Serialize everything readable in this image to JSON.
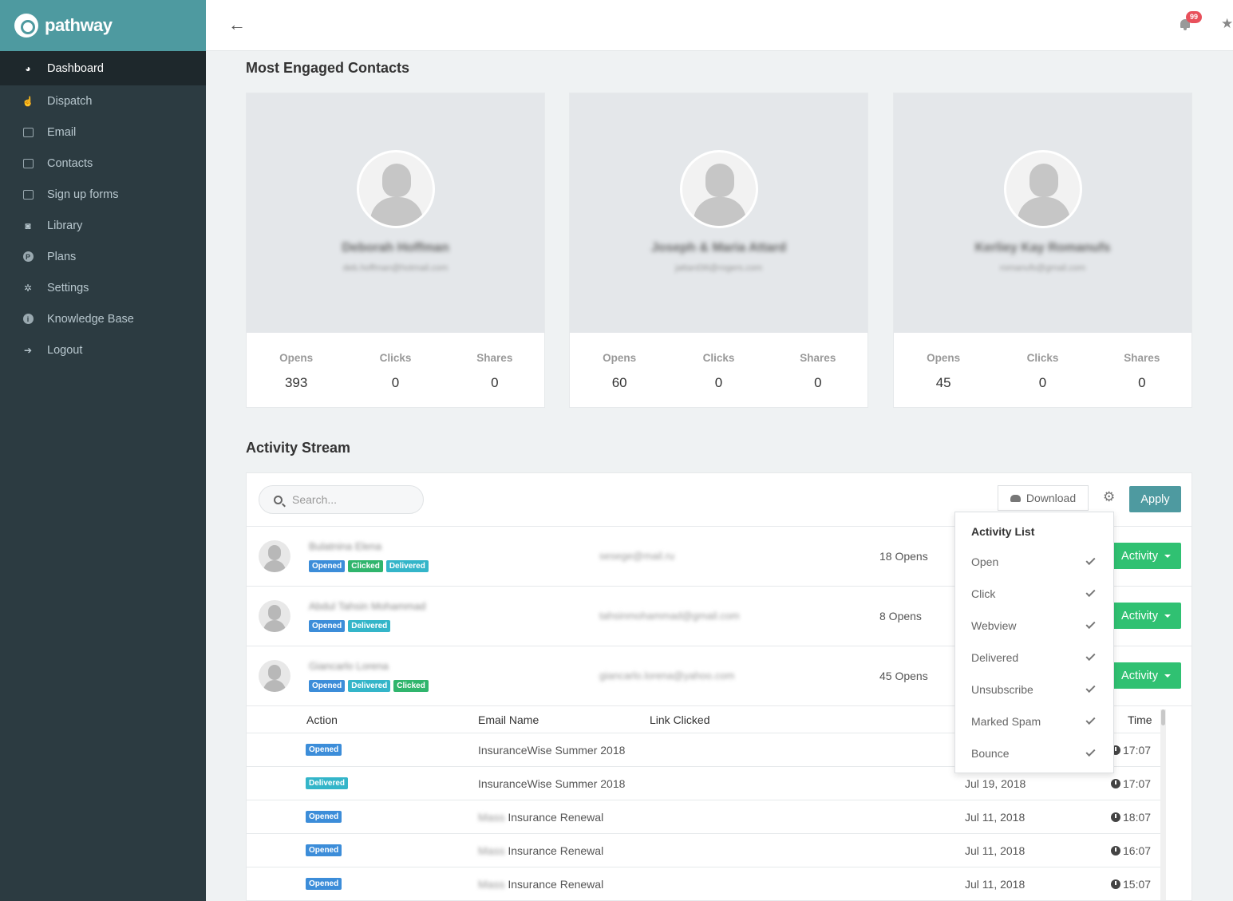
{
  "brand": {
    "name": "pathway"
  },
  "sidebar": {
    "items": [
      {
        "label": "Dashboard"
      },
      {
        "label": "Dispatch"
      },
      {
        "label": "Email"
      },
      {
        "label": "Contacts"
      },
      {
        "label": "Sign up forms"
      },
      {
        "label": "Library"
      },
      {
        "label": "Plans"
      },
      {
        "label": "Settings"
      },
      {
        "label": "Knowledge Base"
      },
      {
        "label": "Logout"
      }
    ]
  },
  "header": {
    "notification_count": "99"
  },
  "engaged": {
    "title": "Most Engaged Contacts",
    "stat_labels": {
      "opens": "Opens",
      "clicks": "Clicks",
      "shares": "Shares"
    },
    "contacts": [
      {
        "name": "Deborah Hoffman",
        "email": "deb.hoffman@hotmail.com",
        "opens": "393",
        "clicks": "0",
        "shares": "0"
      },
      {
        "name": "Joseph & Maria Attard",
        "email": "jattard36@rogers.com",
        "opens": "60",
        "clicks": "0",
        "shares": "0"
      },
      {
        "name": "Kerliey Kay Romanufs",
        "email": "romanufs@gmail.com",
        "opens": "45",
        "clicks": "0",
        "shares": "0"
      }
    ]
  },
  "activity": {
    "title": "Activity Stream",
    "search_placeholder": "Search...",
    "download_label": "Download",
    "apply_label": "Apply",
    "activity_button": "Activity",
    "tag_labels": {
      "opened": "Opened",
      "clicked": "Clicked",
      "delivered": "Delivered"
    },
    "rows": [
      {
        "name": "Bulatnina Elena",
        "email": "sesege@mail.ru",
        "opens": "18 Opens"
      },
      {
        "name": "Abdul Tahsin Mohammad",
        "email": "tahsinmohammad@gmail.com",
        "opens": "8 Opens"
      },
      {
        "name": "Giancarlo Lorena",
        "email": "giancarlo.lorena@yahoo.com",
        "opens": "45 Opens"
      }
    ],
    "detail": {
      "headers": {
        "action": "Action",
        "email_name": "Email Name",
        "link_clicked": "Link Clicked",
        "time": "Time"
      },
      "rows": [
        {
          "action": "Opened",
          "email_name": "InsuranceWise Summer 2018",
          "prefix": "",
          "date": "",
          "time": "17:07",
          "color": "#3c8dd9"
        },
        {
          "action": "Delivered",
          "email_name": "InsuranceWise Summer 2018",
          "prefix": "",
          "date": "Jul 19, 2018",
          "time": "17:07",
          "color": "#34b5c9"
        },
        {
          "action": "Opened",
          "email_name": "Insurance Renewal",
          "prefix": "Mass",
          "date": "Jul 11, 2018",
          "time": "18:07",
          "color": "#3c8dd9"
        },
        {
          "action": "Opened",
          "email_name": "Insurance Renewal",
          "prefix": "Mass",
          "date": "Jul 11, 2018",
          "time": "16:07",
          "color": "#3c8dd9"
        },
        {
          "action": "Opened",
          "email_name": "Insurance Renewal",
          "prefix": "Mass",
          "date": "Jul 11, 2018",
          "time": "15:07",
          "color": "#3c8dd9"
        }
      ]
    }
  },
  "dropdown": {
    "title": "Activity List",
    "items": [
      {
        "label": "Open",
        "checked": true
      },
      {
        "label": "Click",
        "checked": true
      },
      {
        "label": "Webview",
        "checked": true
      },
      {
        "label": "Delivered",
        "checked": true
      },
      {
        "label": "Unsubscribe",
        "checked": true
      },
      {
        "label": "Marked Spam",
        "checked": true
      },
      {
        "label": "Bounce",
        "checked": true
      }
    ]
  },
  "colors": {
    "brand": "#4e9aa0",
    "sidebar": "#2c3b41",
    "activity_button": "#30c172",
    "badge": "#e8505b"
  }
}
